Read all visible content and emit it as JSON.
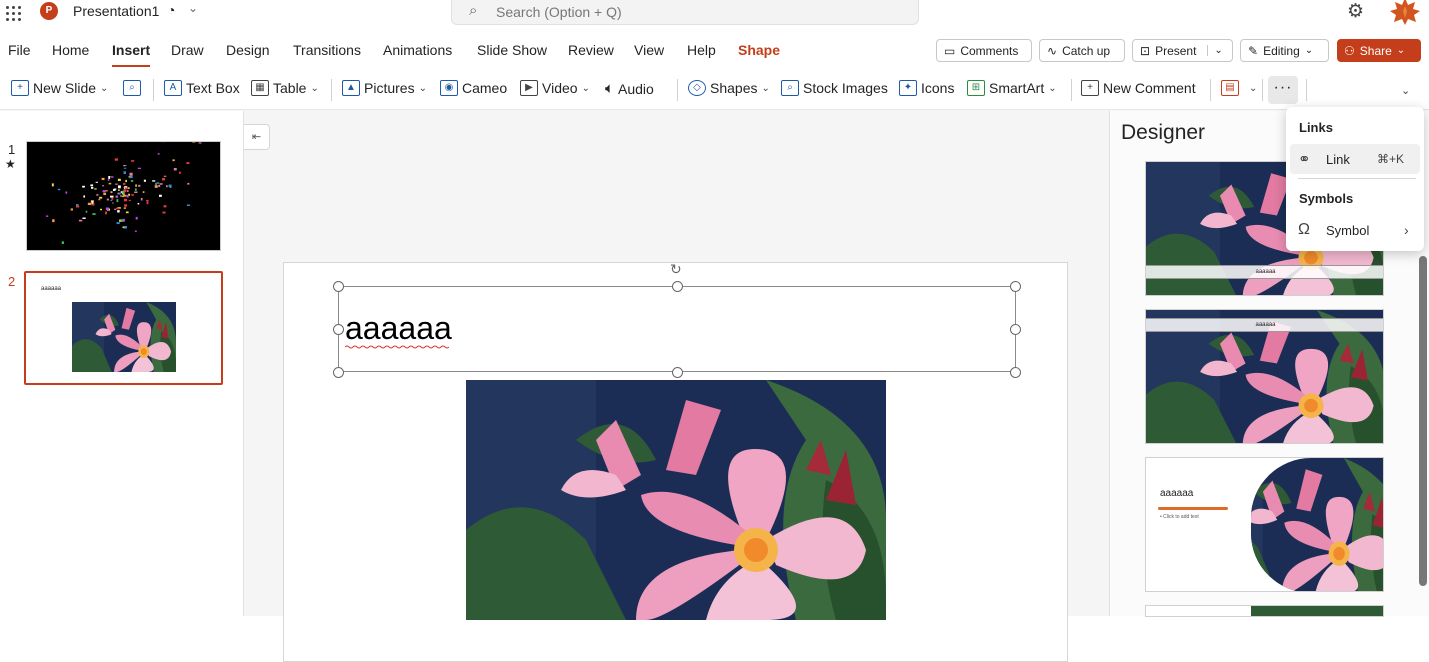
{
  "app": {
    "title": "Presentation1",
    "search_placeholder": "Search (Option + Q)",
    "brand_color": "#c43e1c"
  },
  "menu_tabs": [
    "File",
    "Home",
    "Insert",
    "Draw",
    "Design",
    "Transitions",
    "Animations",
    "Slide Show",
    "Review",
    "View",
    "Help",
    "Shape"
  ],
  "active_tab": "Insert",
  "header_buttons": {
    "comments": "Comments",
    "catch_up": "Catch up",
    "present": "Present",
    "editing": "Editing",
    "share": "Share"
  },
  "ribbon": {
    "new_slide": "New Slide",
    "text_box": "Text Box",
    "table": "Table",
    "pictures": "Pictures",
    "cameo": "Cameo",
    "video": "Video",
    "audio": "Audio",
    "shapes": "Shapes",
    "stock_images": "Stock Images",
    "icons": "Icons",
    "smartart": "SmartArt",
    "new_comment": "New Comment",
    "more": "···"
  },
  "thumbnails": {
    "slide1_number": "1",
    "slide1_star": "★",
    "slide2_number": "2",
    "slide2_title": "aaaaaa"
  },
  "slide": {
    "title_text": "aaaaaa"
  },
  "designer": {
    "title": "Designer",
    "design1_caption": "aaaaaa",
    "design2_caption": "aaaaaa",
    "design3_title": "aaaaaa",
    "design3_sub": "• Click to add text"
  },
  "dropdown": {
    "links_header": "Links",
    "link_label": "Link",
    "link_shortcut": "⌘+K",
    "symbols_header": "Symbols",
    "symbol_label": "Symbol"
  }
}
